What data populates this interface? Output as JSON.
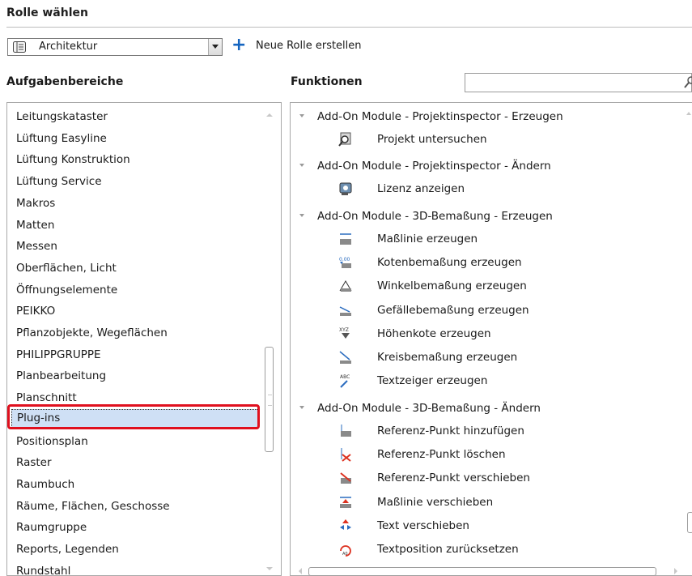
{
  "role_section": {
    "title": "Rolle wählen",
    "selected_role": "Architektur",
    "new_role_label": "Neue Rolle erstellen"
  },
  "aufgaben": {
    "header": "Aufgabenbereiche",
    "items": [
      "Leitungskataster",
      "Lüftung Easyline",
      "Lüftung Konstruktion",
      "Lüftung Service",
      "Makros",
      "Matten",
      "Messen",
      "Oberflächen, Licht",
      "Öffnungselemente",
      "PEIKKO",
      "Pflanzobjekte, Wegeflächen",
      "PHILIPPGRUPPE",
      "Planbearbeitung",
      "Planschnitt",
      "Plug-ins",
      "Positionsplan",
      "Raster",
      "Raumbuch",
      "Räume, Flächen, Geschosse",
      "Raumgruppe",
      "Reports, Legenden",
      "Rundstahl"
    ],
    "selected_item": "Plug-ins"
  },
  "funktionen": {
    "header": "Funktionen",
    "search_value": "",
    "groups": [
      {
        "title": "Add-On Module - Projektinspector - Erzeugen",
        "items": [
          {
            "label": "Projekt untersuchen",
            "icon": "project-inspect-icon"
          }
        ]
      },
      {
        "title": "Add-On Module - Projektinspector - Ändern",
        "items": [
          {
            "label": "Lizenz anzeigen",
            "icon": "license-icon"
          }
        ]
      },
      {
        "title": "Add-On Module - 3D-Bemaßung - Erzeugen",
        "items": [
          {
            "label": "Maßlinie erzeugen",
            "icon": "dimension-line-icon"
          },
          {
            "label": "Kotenbemaßung erzeugen",
            "icon": "elevation-dimension-icon"
          },
          {
            "label": "Winkelbemaßung erzeugen",
            "icon": "angle-dimension-icon"
          },
          {
            "label": "Gefällebemaßung erzeugen",
            "icon": "slope-dimension-icon"
          },
          {
            "label": "Höhenkote erzeugen",
            "icon": "height-marker-icon"
          },
          {
            "label": "Kreisbemaßung erzeugen",
            "icon": "circle-dimension-icon"
          },
          {
            "label": "Textzeiger erzeugen",
            "icon": "text-pointer-icon"
          }
        ]
      },
      {
        "title": "Add-On Module - 3D-Bemaßung - Ändern",
        "items": [
          {
            "label": "Referenz-Punkt hinzufügen",
            "icon": "ref-point-add-icon"
          },
          {
            "label": "Referenz-Punkt löschen",
            "icon": "ref-point-delete-icon"
          },
          {
            "label": "Referenz-Punkt verschieben",
            "icon": "ref-point-move-icon"
          },
          {
            "label": "Maßlinie verschieben",
            "icon": "dimension-line-move-icon"
          },
          {
            "label": "Text verschieben",
            "icon": "text-move-icon"
          },
          {
            "label": "Textposition zurücksetzen",
            "icon": "text-reset-icon"
          }
        ]
      }
    ]
  },
  "colors": {
    "selection_bg": "#cfe0f5",
    "highlight_border": "#e0101e",
    "accent": "#1565c0"
  }
}
